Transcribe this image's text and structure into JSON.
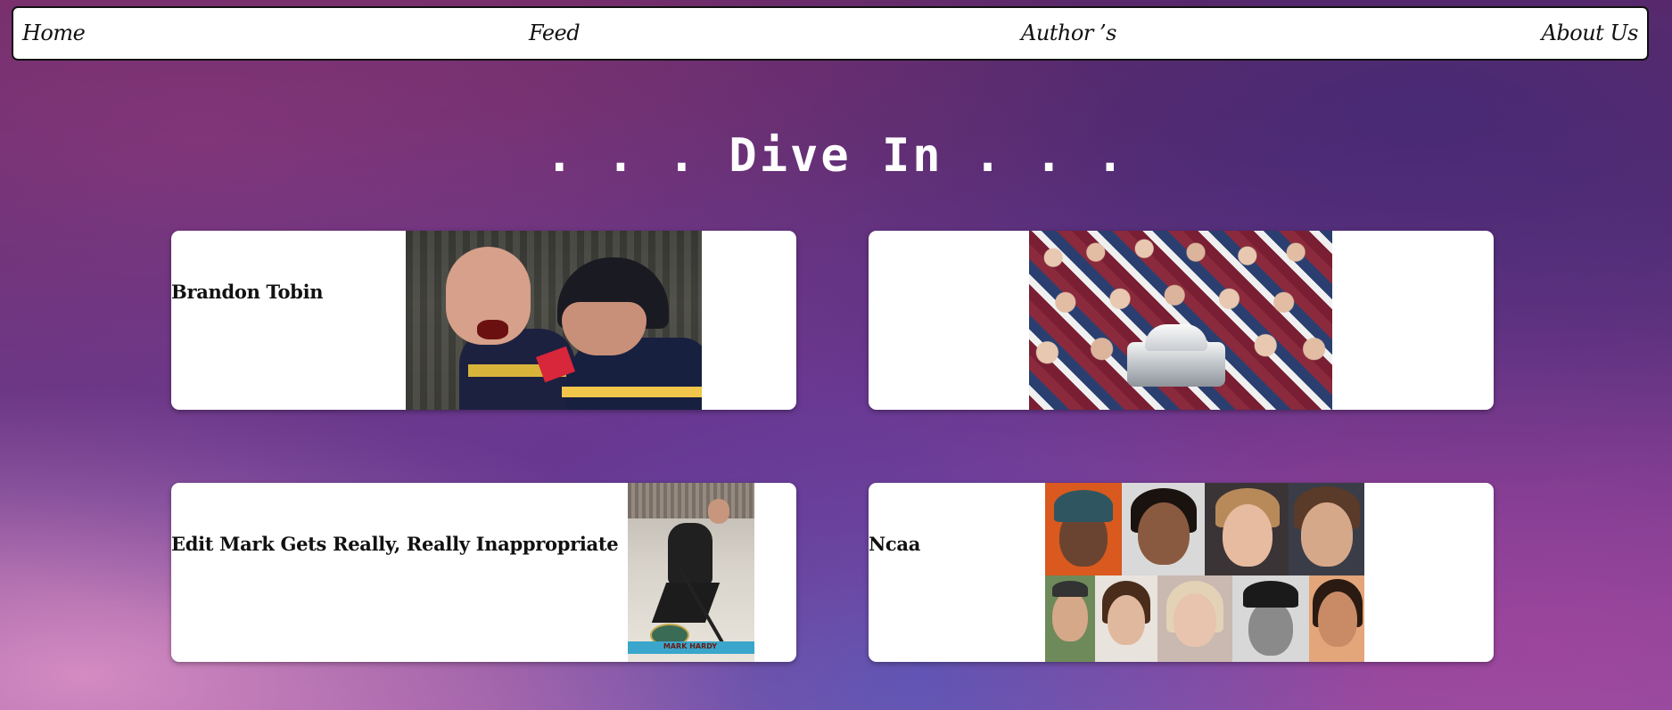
{
  "nav": {
    "home": "Home",
    "feed": "Feed",
    "authors": "Author ’s",
    "about": "About Us"
  },
  "page": {
    "title": ". . . Dive In . . ."
  },
  "cards": [
    {
      "title": "Brandon Tobin"
    },
    {
      "title": ""
    },
    {
      "title": "Edit Mark Gets Really, Really Inappropriate",
      "card_caption": "MARK HARDY"
    },
    {
      "title": "Ncaa"
    }
  ]
}
